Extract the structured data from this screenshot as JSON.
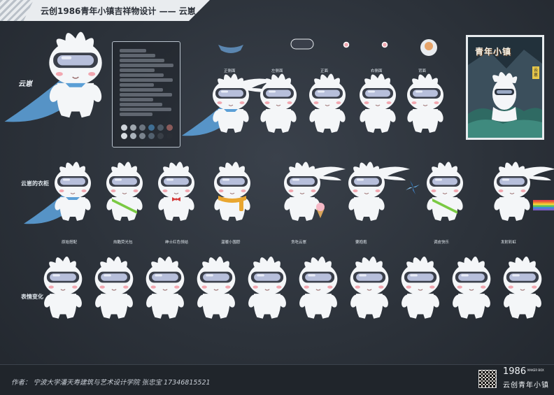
{
  "header": {
    "title": "云创1986青年小镇吉祥物设计 —— 云崽"
  },
  "mascot": {
    "name": "云崽"
  },
  "views": [
    {
      "label": "正侧面"
    },
    {
      "label": "左侧面"
    },
    {
      "label": "正面"
    },
    {
      "label": "右侧面"
    },
    {
      "label": "背面"
    }
  ],
  "sections": {
    "outfits": "云崽的衣柜",
    "expressions": "表情变化"
  },
  "outfits": [
    {
      "label": "原始搭配"
    },
    {
      "label": "炫酷荧光包"
    },
    {
      "label": "绅士红色领结"
    },
    {
      "label": "温暖小围脖"
    },
    {
      "label": "贪吃云崽"
    },
    {
      "label": "要抱抱"
    },
    {
      "label": "调皮快乐"
    },
    {
      "label": "发射彩虹"
    }
  ],
  "poster": {
    "title": "青年小镇",
    "tag": "云崽"
  },
  "footer": {
    "author": "作者：  宁波大学潘天寿建筑与艺术设计学院  张忠宝  17346815521",
    "logo_year": "1986",
    "logo_sub_1": "MAKER",
    "logo_sub_2": "BOX",
    "logo_cn": "云创青年小镇"
  },
  "colors": {
    "background": "#2c323a",
    "banner": "#e9ecef",
    "mascot_body": "#f4f6f8",
    "goggles": "#3a3f4a",
    "cape": "#5b9fd6",
    "strap": "#7ac943",
    "bowtie": "#d63b3b",
    "scarf": "#e9a630",
    "swatches": [
      "#cfd4da",
      "#9fa6ae",
      "#6c7580",
      "#3f6e93",
      "#4e5a66",
      "#8a5a5a",
      "#d9dee3",
      "#aab2bb",
      "#7a838d",
      "#52606e",
      "#393f47",
      "#2a2f36"
    ]
  },
  "icons": {
    "view_accessories": [
      "mask-icon",
      "goggles-icon",
      "cheek-dot-icon",
      "cheek-dot-icon",
      "icecream-icon"
    ],
    "pinwheel": "pinwheel-icon",
    "rainbow": "rainbow-icon"
  }
}
